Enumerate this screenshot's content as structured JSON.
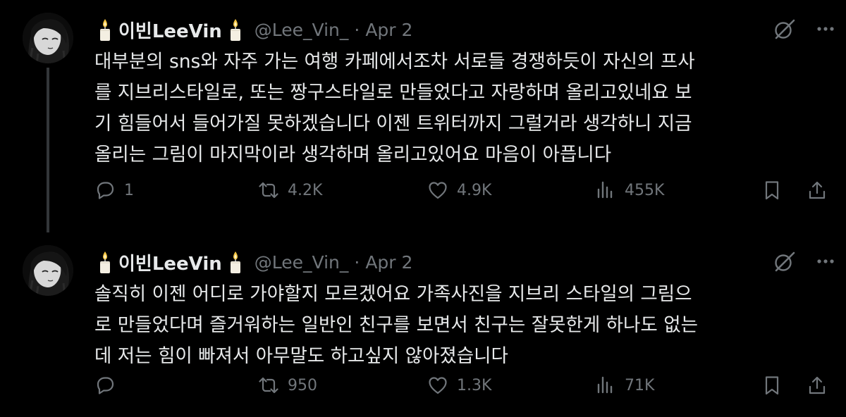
{
  "tweets": [
    {
      "display_name": "이빈LeeVin",
      "handle": "@Lee_Vin_",
      "separator": "·",
      "date": "Apr 2",
      "text": "대부분의 sns와 자주 가는 여행 카페에서조차 서로들 경쟁하듯이 자신의 프사\n를 지브리스타일로, 또는 짱구스타일로 만들었다고 자랑하며 올리고있네요 보\n기 힘들어서 들어가질 못하겠습니다 이젠 트위터까지 그럴거라 생각하니 지금\n올리는 그림이 마지막이라 생각하며 올리고있어요 마음이 아픕니다",
      "replies": "1",
      "retweets": "4.2K",
      "likes": "4.9K",
      "views": "455K"
    },
    {
      "display_name": "이빈LeeVin",
      "handle": "@Lee_Vin_",
      "separator": "·",
      "date": "Apr 2",
      "text": "솔직히 이젠 어디로 가야할지 모르겠어요 가족사진을 지브리 스타일의 그림으\n로 만들었다며 즐거워하는 일반인 친구를 보면서 친구는 잘못한게 하나도 없는\n데 저는 힘이 빠져서 아무말도 하고싶지 않아졌습니다",
      "replies": "",
      "retweets": "950",
      "likes": "1.3K",
      "views": "71K"
    }
  ],
  "icons": [
    "candle-icon",
    "grok-icon",
    "more-icon",
    "reply-icon",
    "retweet-icon",
    "like-icon",
    "views-icon",
    "bookmark-icon",
    "share-icon"
  ],
  "colors": {
    "background": "#000000",
    "text": "#e7e9ea",
    "secondary": "#71767b",
    "thread_line": "#333639"
  }
}
